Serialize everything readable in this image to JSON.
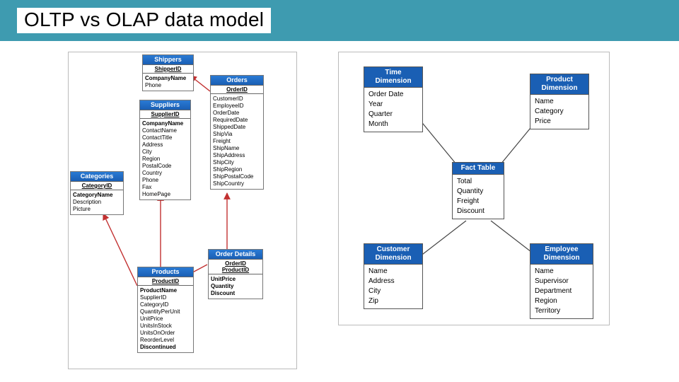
{
  "title": "OLTP vs OLAP data model",
  "oltp": {
    "shippers": {
      "name": "Shippers",
      "pk": "ShipperID",
      "fields": [
        "CompanyName",
        "Phone"
      ],
      "bold": [
        0
      ]
    },
    "suppliers": {
      "name": "Suppliers",
      "pk": "SupplierID",
      "fields": [
        "CompanyName",
        "ContactName",
        "ContactTitle",
        "Address",
        "City",
        "Region",
        "PostalCode",
        "Country",
        "Phone",
        "Fax",
        "HomePage"
      ],
      "bold": [
        0
      ]
    },
    "categories": {
      "name": "Categories",
      "pk": "CategoryID",
      "fields": [
        "CategoryName",
        "Description",
        "Picture"
      ],
      "bold": [
        0
      ]
    },
    "products": {
      "name": "Products",
      "pk": "ProductID",
      "fields": [
        "ProductName",
        "SupplierID",
        "CategoryID",
        "QuantityPerUnit",
        "UnitPrice",
        "UnitsInStock",
        "UnitsOnOrder",
        "ReorderLevel",
        "Discontinued"
      ],
      "bold": [
        0,
        8
      ]
    },
    "orders": {
      "name": "Orders",
      "pk": "OrderID",
      "fields": [
        "CustomerID",
        "EmployeeID",
        "OrderDate",
        "RequiredDate",
        "ShippedDate",
        "ShipVia",
        "Freight",
        "ShipName",
        "ShipAddress",
        "ShipCity",
        "ShipRegion",
        "ShipPostalCode",
        "ShipCountry"
      ],
      "bold": []
    },
    "orderdetails": {
      "name": "Order Details",
      "pk": "OrderID\nProductID",
      "fields": [
        "UnitPrice",
        "Quantity",
        "Discount"
      ],
      "bold": [
        0,
        1,
        2
      ]
    }
  },
  "olap": {
    "time": {
      "name": "Time Dimension",
      "fields": [
        "Order Date",
        "Year",
        "Quarter",
        "Month"
      ]
    },
    "product": {
      "name": "Product Dimension",
      "fields": [
        "Name",
        "Category",
        "Price"
      ]
    },
    "fact": {
      "name": "Fact Table",
      "fields": [
        "Total",
        "Quantity",
        "Freight",
        "Discount"
      ]
    },
    "customer": {
      "name": "Customer Dimension",
      "fields": [
        "Name",
        "Address",
        "City",
        "Zip"
      ]
    },
    "employee": {
      "name": "Employee Dimension",
      "fields": [
        "Name",
        "Supervisor",
        "Department",
        "Region",
        "Territory"
      ]
    }
  }
}
